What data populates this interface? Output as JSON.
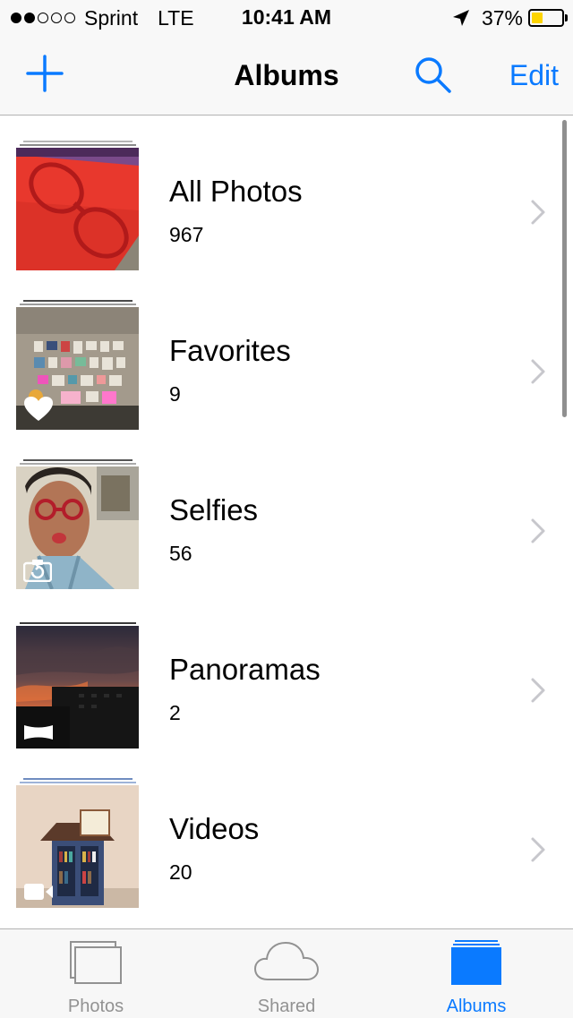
{
  "status_bar": {
    "carrier": "Sprint",
    "network": "LTE",
    "time": "10:41 AM",
    "battery_percent": "37%",
    "battery_level": 0.37,
    "signal_bars": 2,
    "signal_total": 5
  },
  "nav": {
    "title": "Albums",
    "edit_label": "Edit",
    "accent_color": "#0a7aff"
  },
  "albums": [
    {
      "name": "All Photos",
      "count": "967"
    },
    {
      "name": "Favorites",
      "count": "9",
      "badge_icon": "heart-icon"
    },
    {
      "name": "Selfies",
      "count": "56",
      "badge_icon": "front-camera-icon"
    },
    {
      "name": "Panoramas",
      "count": "2",
      "badge_icon": "panorama-icon"
    },
    {
      "name": "Videos",
      "count": "20",
      "badge_icon": "video-camera-icon"
    }
  ],
  "tabs": [
    {
      "label": "Photos",
      "icon": "photos-icon",
      "active": false
    },
    {
      "label": "Shared",
      "icon": "cloud-icon",
      "active": false
    },
    {
      "label": "Albums",
      "icon": "albums-icon",
      "active": true
    }
  ]
}
